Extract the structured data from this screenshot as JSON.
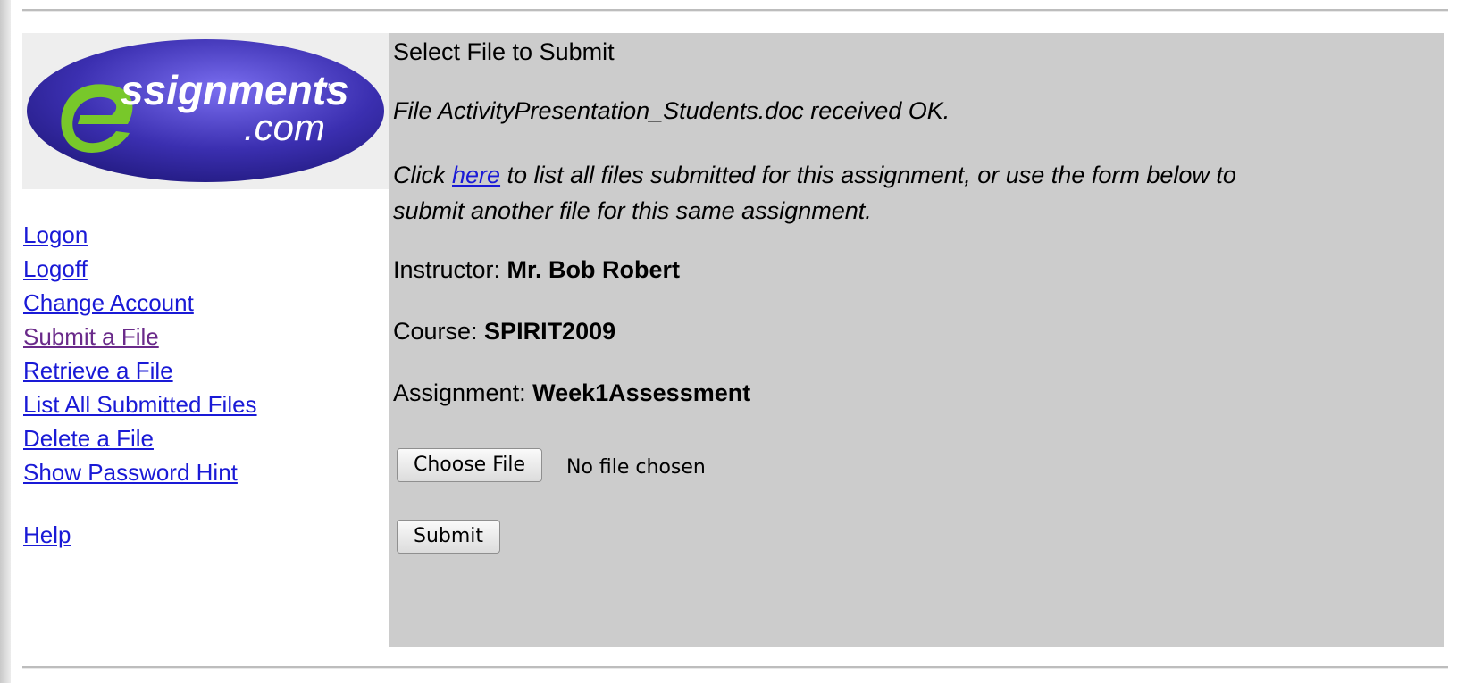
{
  "logo": {
    "brand_text": "ssignments",
    "tm": "™",
    "domain": ".com",
    "colors": {
      "ellipse": "#3b2fb0",
      "ellipse_light": "#6a5ee0",
      "swoosh": "#78c82a"
    }
  },
  "nav": {
    "items": [
      {
        "label": "Logon"
      },
      {
        "label": "Logoff"
      },
      {
        "label": "Change Account"
      },
      {
        "label": "Submit a File"
      },
      {
        "label": "Retrieve a File"
      },
      {
        "label": "List All Submitted Files"
      },
      {
        "label": "Delete a File"
      },
      {
        "label": "Show Password Hint"
      }
    ],
    "help": "Help"
  },
  "main": {
    "title": "Select File to Submit",
    "received_msg": "File ActivityPresentation_Students.doc received OK.",
    "click_prefix": "Click ",
    "here_link": "here",
    "click_suffix": " to list all files submitted for this assignment, or use the form below to",
    "click_line2": "submit another file for this same assignment.",
    "instructor_label": "Instructor: ",
    "instructor_value": "Mr. Bob Robert",
    "course_label": "Course: ",
    "course_value": "SPIRIT2009",
    "assignment_label": "Assignment: ",
    "assignment_value": "Week1Assessment",
    "choose_file_label": "Choose File",
    "no_file_text": "No file chosen",
    "submit_label": "Submit"
  },
  "colors": {
    "panel_bg": "#cccccc",
    "link": "#1a1ad6",
    "visited_link": "#6a2a8a"
  }
}
